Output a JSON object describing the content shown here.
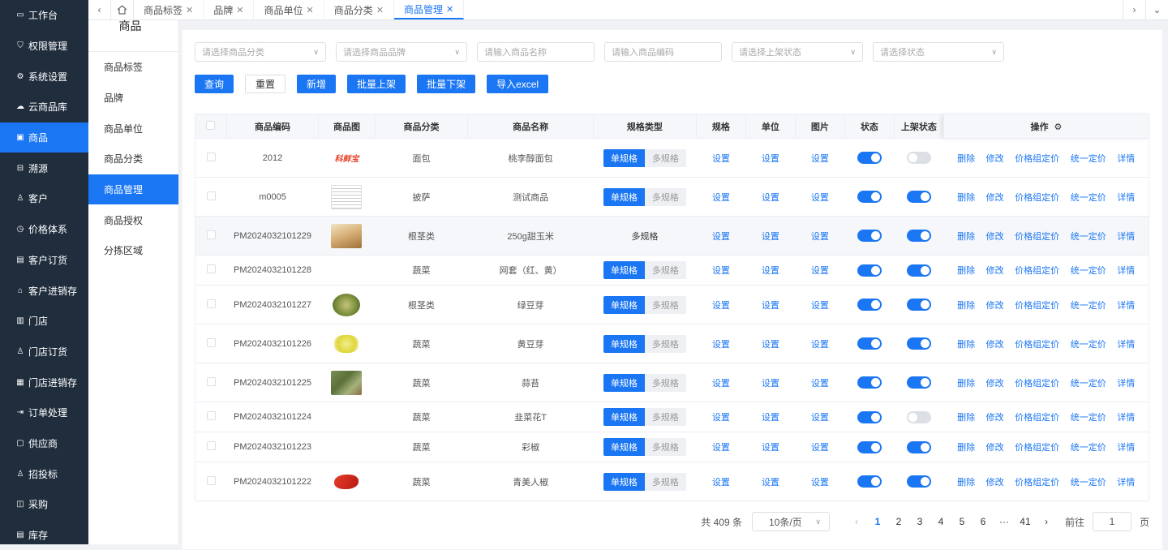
{
  "sidebar": {
    "items": [
      {
        "label": "工作台",
        "icon": "monitor-icon"
      },
      {
        "label": "权限管理",
        "icon": "shield-icon"
      },
      {
        "label": "系统设置",
        "icon": "gear-icon"
      },
      {
        "label": "云商品库",
        "icon": "cloud-icon"
      },
      {
        "label": "商品",
        "icon": "goods-icon",
        "active": true
      },
      {
        "label": "溯源",
        "icon": "trace-icon"
      },
      {
        "label": "客户",
        "icon": "customer-icon"
      },
      {
        "label": "价格体系",
        "icon": "price-icon"
      },
      {
        "label": "客户订货",
        "icon": "order-icon"
      },
      {
        "label": "客户进销存",
        "icon": "warehouse-icon"
      },
      {
        "label": "门店",
        "icon": "store-icon"
      },
      {
        "label": "门店订货",
        "icon": "store-order-icon"
      },
      {
        "label": "门店进销存",
        "icon": "store-stock-icon"
      },
      {
        "label": "订单处理",
        "icon": "process-icon"
      },
      {
        "label": "供应商",
        "icon": "supplier-icon"
      },
      {
        "label": "招投标",
        "icon": "bid-icon"
      },
      {
        "label": "采购",
        "icon": "purchase-icon"
      },
      {
        "label": "库存",
        "icon": "stock-icon"
      }
    ]
  },
  "subnav": {
    "title": "商品",
    "items": [
      "商品标签",
      "品牌",
      "商品单位",
      "商品分类",
      "商品管理",
      "商品授权",
      "分拣区域"
    ]
  },
  "tabs": {
    "home_icon": "home-icon",
    "items": [
      "商品标签",
      "品牌",
      "商品单位",
      "商品分类",
      "商品管理"
    ]
  },
  "filters": {
    "category": "请选择商品分类",
    "brand": "请选择商品品牌",
    "name": "请输入商品名称",
    "code": "请输入商品编码",
    "shelf_status": "请选择上架状态",
    "status": "请选择状态"
  },
  "buttons": {
    "query": "查询",
    "reset": "重置",
    "add": "新增",
    "batch_on": "批量上架",
    "batch_off": "批量下架",
    "import": "导入excel"
  },
  "table": {
    "headers": [
      "商品编码",
      "商品图",
      "商品分类",
      "商品名称",
      "规格类型",
      "规格",
      "单位",
      "图片",
      "状态",
      "上架状态",
      "操作"
    ],
    "seg_single": "单规格",
    "seg_multi": "多规格",
    "setting_label": "设置",
    "ops": [
      "删除",
      "修改",
      "价格组定价",
      "统一定价",
      "详情"
    ],
    "rows": [
      {
        "code": "2012",
        "image": "logo",
        "image_text": "科鲜宝",
        "category": "面包",
        "name": "桃李醇面包",
        "spec_type": "segmented",
        "status_on": true,
        "shelf_on": false
      },
      {
        "code": "m0005",
        "image": "document",
        "category": "披萨",
        "name": "测试商品",
        "spec_type": "segmented",
        "status_on": true,
        "shelf_on": true
      },
      {
        "code": "PM2024032101229",
        "image": "corn",
        "category": "根茎类",
        "name": "250g甜玉米",
        "spec_type": "text",
        "spec_text": "多规格",
        "status_on": true,
        "shelf_on": true,
        "highlight": true
      },
      {
        "code": "PM2024032101228",
        "image": "none",
        "category": "蔬菜",
        "name": "网套（红、黄）",
        "spec_type": "segmented",
        "status_on": true,
        "shelf_on": true
      },
      {
        "code": "PM2024032101227",
        "image": "sprouts",
        "category": "根茎类",
        "name": "绿豆芽",
        "spec_type": "segmented",
        "status_on": true,
        "shelf_on": true
      },
      {
        "code": "PM2024032101226",
        "image": "yellow_sprouts",
        "category": "蔬菜",
        "name": "黄豆芽",
        "spec_type": "segmented",
        "status_on": true,
        "shelf_on": true
      },
      {
        "code": "PM2024032101225",
        "image": "garlic",
        "category": "蔬菜",
        "name": "蒜苔",
        "spec_type": "segmented",
        "status_on": true,
        "shelf_on": true
      },
      {
        "code": "PM2024032101224",
        "image": "none",
        "category": "蔬菜",
        "name": "韭菜花T",
        "spec_type": "segmented",
        "status_on": true,
        "shelf_on": false
      },
      {
        "code": "PM2024032101223",
        "image": "none",
        "category": "蔬菜",
        "name": "彩椒",
        "spec_type": "segmented",
        "status_on": true,
        "shelf_on": true
      },
      {
        "code": "PM2024032101222",
        "image": "pepper",
        "category": "蔬菜",
        "name": "青美人椒",
        "spec_type": "segmented",
        "status_on": true,
        "shelf_on": true
      }
    ]
  },
  "pagination": {
    "total": "共 409 条",
    "page_size": "10条/页",
    "pages": [
      "1",
      "2",
      "3",
      "4",
      "5",
      "6"
    ],
    "ellipsis": "···",
    "last": "41",
    "goto_label": "前往",
    "goto_value": "1",
    "page_suffix": "页"
  }
}
